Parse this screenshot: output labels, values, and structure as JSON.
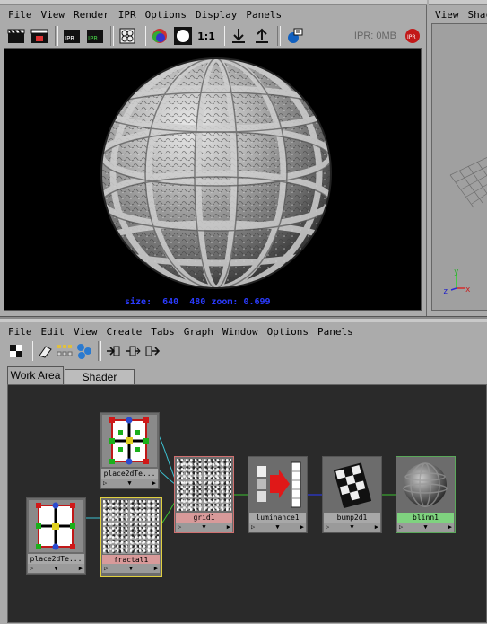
{
  "render_view": {
    "menu": [
      "File",
      "View",
      "Render",
      "IPR",
      "Options",
      "Display",
      "Panels"
    ],
    "ipr_memory": "IPR: 0MB",
    "zoom_button_label": "1:1",
    "status_text": "size:  640  480 zoom: 0.699"
  },
  "side_panel": {
    "menu": [
      "View",
      "Shac"
    ],
    "axes": {
      "y": "y",
      "x": "x",
      "z": "z"
    }
  },
  "hypershade": {
    "menu": [
      "File",
      "Edit",
      "View",
      "Create",
      "Tabs",
      "Graph",
      "Window",
      "Options",
      "Panels"
    ],
    "tabs": [
      {
        "label": "Work Area",
        "active": true
      },
      {
        "label": "Shader Library",
        "active": false
      }
    ],
    "nodes": {
      "place2d_a": "place2dTe...",
      "place2d_b": "place2dTe...",
      "fractal": "fractal1",
      "grid": "grid1",
      "luminance": "luminance1",
      "bump": "bump2d1",
      "blinn": "blinn1"
    },
    "colors": {
      "graph_bg": "#2a2a2a",
      "texture_label": "#d89a9a",
      "material_label": "#7fd27f",
      "utility_label": "#a8a8a8",
      "selected_border": "#e0d040"
    }
  }
}
